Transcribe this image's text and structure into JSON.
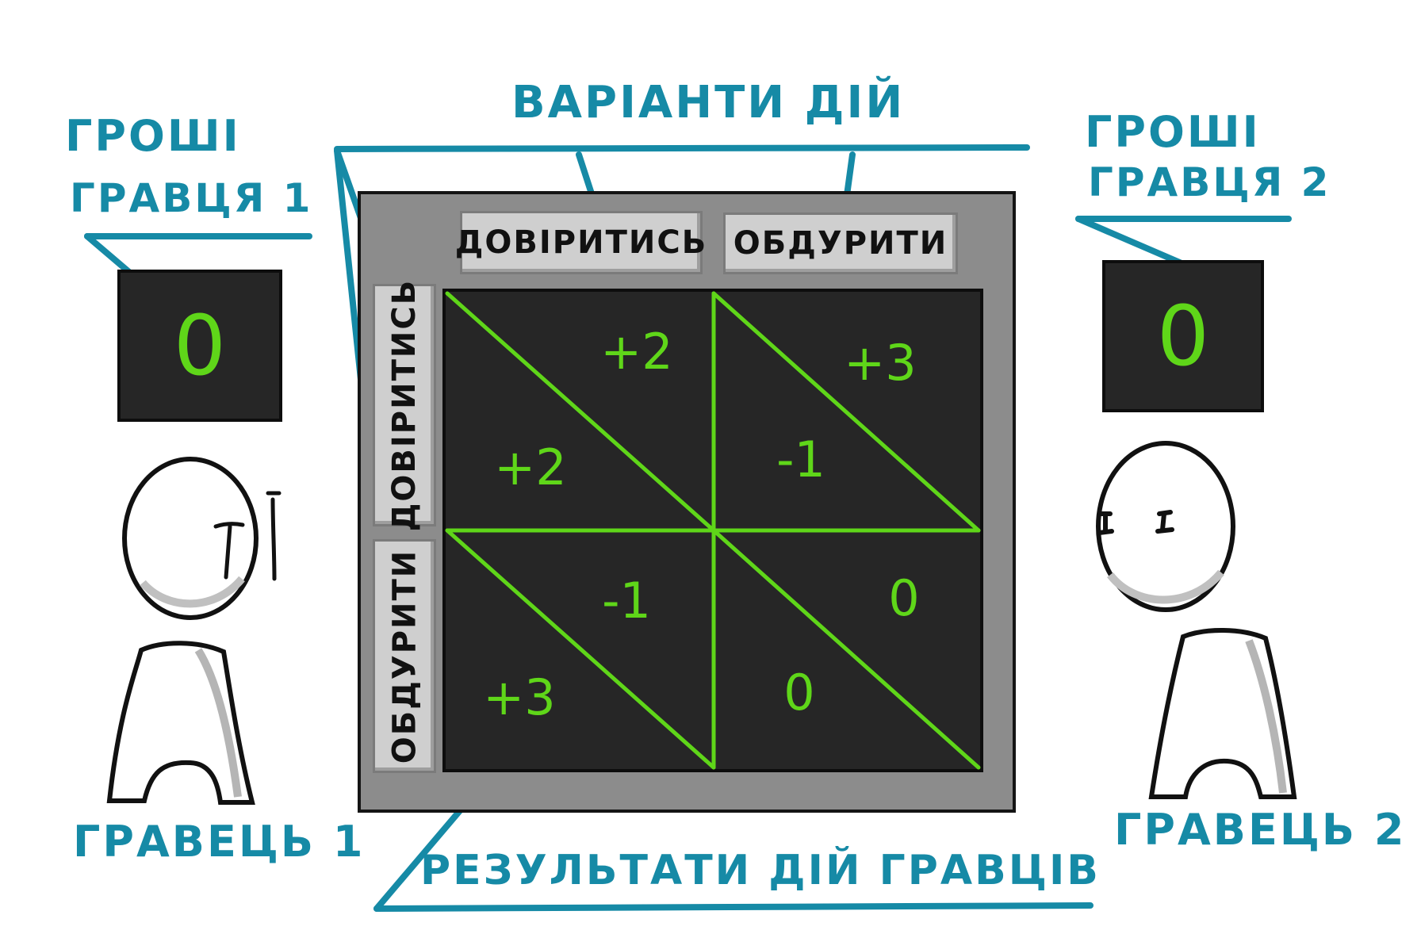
{
  "labels": {
    "actions": "ВАРІАНТИ ДІЙ",
    "money_p1_line1": "ГРОШІ",
    "money_p1_line2": "ГРАВЦЯ 1",
    "money_p2_line1": "ГРОШІ",
    "money_p2_line2": "ГРАВЦЯ 2",
    "player1": "ГРАВЕЦЬ 1",
    "player2": "ГРАВЕЦЬ 2",
    "results": "РЕЗУЛЬТАТИ ДІЙ ГРАВЦІВ"
  },
  "buttons": {
    "top_trust": "ДОВІРИТИСЬ",
    "top_cheat": "ОБДУРИТИ",
    "side_trust": "ДОВІРИТИСЬ",
    "side_cheat": "ОБДУРИТИ"
  },
  "money": {
    "player1": "0",
    "player2": "0"
  },
  "payoffs": {
    "trust_trust": {
      "p1": "+2",
      "p2": "+2"
    },
    "trust_cheat": {
      "p1": "-1",
      "p2": "+3"
    },
    "cheat_trust": {
      "p1": "+3",
      "p2": "-1"
    },
    "cheat_cheat": {
      "p1": "0",
      "p2": "0"
    }
  },
  "colors": {
    "annotation": "#168aa6",
    "matrix_line": "#5fd619",
    "panel": "#8c8c8c",
    "screen": "#262626"
  }
}
